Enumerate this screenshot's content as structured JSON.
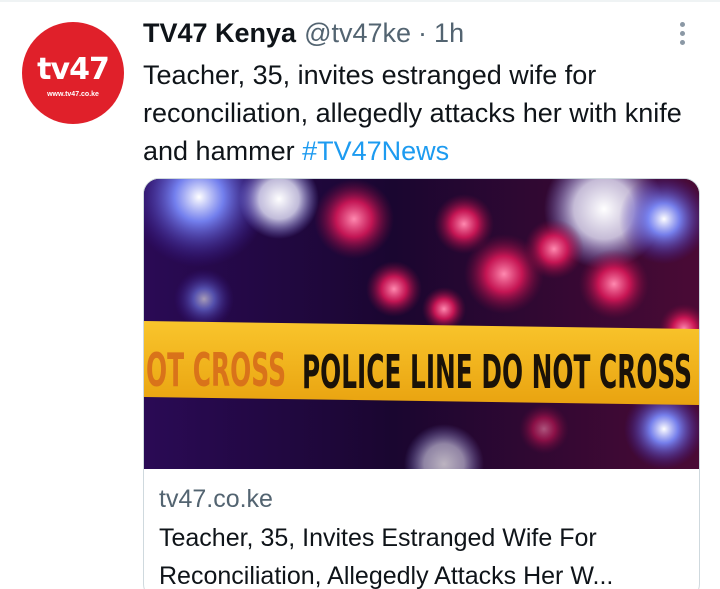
{
  "tweet": {
    "author_name": "TV47 Kenya",
    "handle": "@tv47ke",
    "separator": "·",
    "time": "1h",
    "text": "Teacher, 35, invites estranged wife for reconciliation, allegedly attacks her with knife and hammer",
    "hashtag": "#TV47News",
    "avatar": {
      "logo_text": "tv47",
      "logo_subtext": "www.tv47.co.ke",
      "color": "#e0202a"
    }
  },
  "card": {
    "image": {
      "tape_text_left": "OT CROSS",
      "tape_text_main": "POLICE LINE DO NOT CROSS",
      "tape_color": "#f5b418"
    },
    "domain": "tv47.co.ke",
    "title": "Teacher, 35, Invites Estranged Wife For Reconciliation, Allegedly Attacks Her W..."
  },
  "icons": {
    "more": "more-dots-vertical-icon"
  },
  "colors": {
    "hashtag": "#1d9bf0",
    "secondary_text": "#536471"
  }
}
